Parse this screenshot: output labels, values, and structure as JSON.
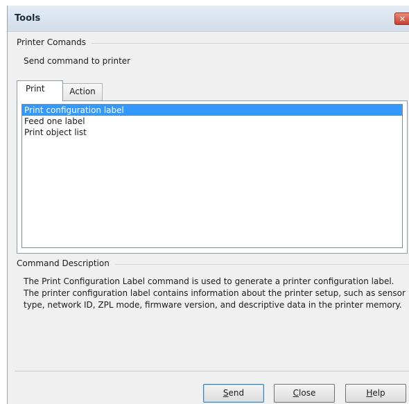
{
  "window": {
    "title": "Tools",
    "close_glyph": "✕"
  },
  "printer_commands": {
    "group_label": "Printer Comands",
    "instruction": "Send command to printer"
  },
  "tabs": [
    {
      "label": "Print",
      "active": true
    },
    {
      "label": "Action",
      "active": false
    }
  ],
  "commands": {
    "items": [
      {
        "label": "Print configuration label",
        "selected": true
      },
      {
        "label": "Feed one label",
        "selected": false
      },
      {
        "label": "Print object list",
        "selected": false
      }
    ]
  },
  "command_description": {
    "group_label": "Command Description",
    "text": "The Print Configuration Label command is used to generate a printer configuration label. The printer configuration label contains information about the printer setup, such as sensor type, network ID, ZPL mode, firmware version, and descriptive data in the printer memory."
  },
  "buttons": {
    "send": {
      "accel": "S",
      "rest": "end"
    },
    "close": {
      "accel": "C",
      "rest": "lose"
    },
    "help": {
      "accel": "H",
      "rest": "elp"
    }
  },
  "colors": {
    "selection": "#3399ff",
    "close_button": "#c4412f",
    "window_bg": "#f0f0f0"
  }
}
